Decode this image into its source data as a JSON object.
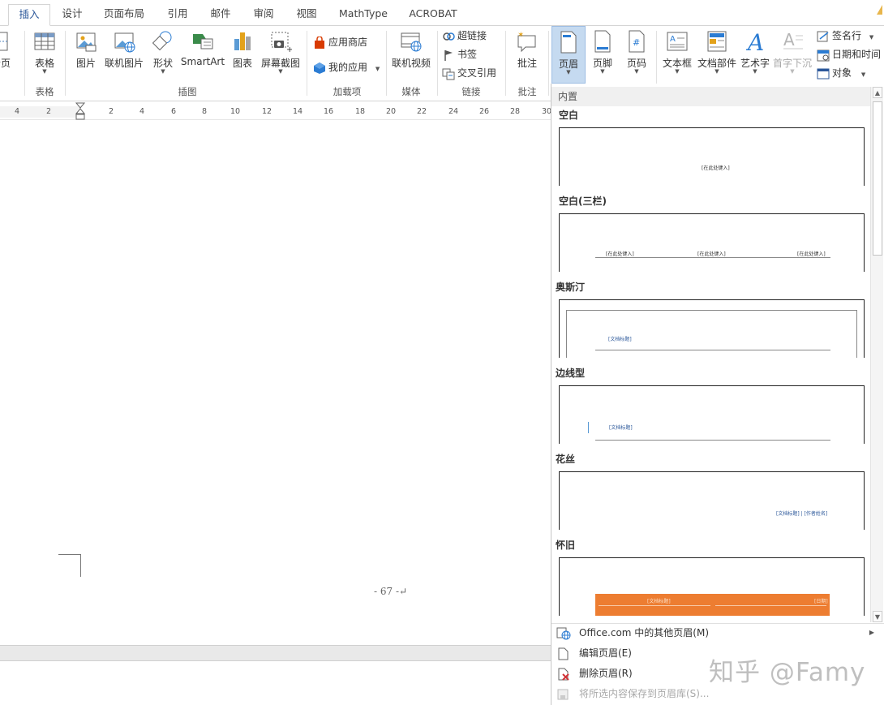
{
  "tabs": [
    {
      "label": "插入",
      "active": true
    },
    {
      "label": "设计"
    },
    {
      "label": "页面布局"
    },
    {
      "label": "引用"
    },
    {
      "label": "邮件"
    },
    {
      "label": "审阅"
    },
    {
      "label": "视图"
    },
    {
      "label": "MathType"
    },
    {
      "label": "ACROBAT"
    }
  ],
  "ribbon": {
    "cut_page_label": "分页",
    "table": {
      "label": "表格",
      "group": "表格"
    },
    "illustrations": {
      "group": "插图",
      "picture": "图片",
      "online_picture": "联机图片",
      "shapes": "形状",
      "smartart": "SmartArt",
      "chart": "图表",
      "screenshot": "屏幕截图"
    },
    "addins": {
      "group": "加载项",
      "store": "应用商店",
      "my_apps": "我的应用"
    },
    "media": {
      "group": "媒体",
      "online_video": "联机视频"
    },
    "links": {
      "group": "链接",
      "hyperlink": "超链接",
      "bookmark": "书签",
      "cross_ref": "交叉引用"
    },
    "comments": {
      "group": "批注",
      "comment": "批注"
    },
    "header_footer": {
      "header": "页眉",
      "footer": "页脚",
      "page_number": "页码"
    },
    "text": {
      "textbox": "文本框",
      "quickparts": "文档部件",
      "wordart": "艺术字",
      "dropcap": "首字下沉",
      "signature": "签名行",
      "datetime": "日期和时间",
      "object": "对象"
    }
  },
  "ruler": {
    "labels": [
      "4",
      "2",
      "2",
      "2",
      "4",
      "6",
      "8",
      "10",
      "12",
      "14",
      "16",
      "18",
      "20",
      "22",
      "24",
      "26",
      "28",
      "30"
    ]
  },
  "document": {
    "page_number": "- 67 -↵"
  },
  "gallery": {
    "section_header": "内置",
    "items": [
      {
        "name": "空白",
        "texts": [
          "[在此处键入]"
        ]
      },
      {
        "name": "空白(三栏)",
        "texts": [
          "[在此处键入]",
          "[在此处键入]",
          "[在此处键入]"
        ]
      },
      {
        "name": "奥斯汀",
        "texts": [
          "[文档标题]"
        ]
      },
      {
        "name": "边线型",
        "texts": [
          "[文档标题]"
        ]
      },
      {
        "name": "花丝",
        "texts": [
          "[文档标题] | [作者姓名]"
        ]
      },
      {
        "name": "怀旧",
        "texts": [
          "[文档标题]",
          "[日期]"
        ]
      }
    ],
    "menu": [
      {
        "label": "Office.com 中的其他页眉(M)",
        "icon": "office-globe-icon",
        "has_submenu": true
      },
      {
        "label": "编辑页眉(E)",
        "icon": "page-icon"
      },
      {
        "label": "删除页眉(R)",
        "icon": "delete-page-icon"
      },
      {
        "label": "将所选内容保存到页眉库(S)...",
        "icon": "save-gallery-icon",
        "disabled": true
      }
    ]
  },
  "watermark": "知乎 @Famy",
  "colors": {
    "accent": "#2b579a",
    "orange": "#ed7d31",
    "ribbon_selected": "#c5daf0"
  }
}
